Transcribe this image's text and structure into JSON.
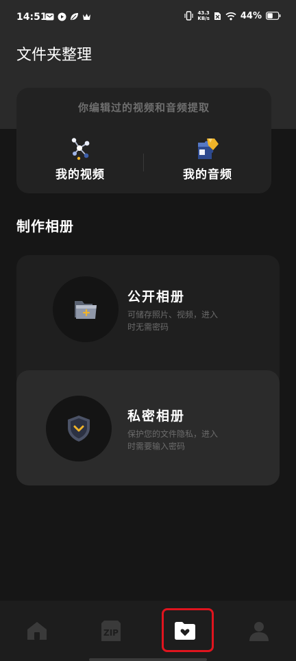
{
  "status_bar": {
    "time": "14:51",
    "net_speed_value": "43.3",
    "net_speed_unit": "KB/s",
    "battery_percent": "44%"
  },
  "page": {
    "title": "文件夹整理"
  },
  "extract_card": {
    "subtitle": "你编辑过的视频和音频提取",
    "items": [
      {
        "label": "我的视频",
        "icon": "video-dots-icon"
      },
      {
        "label": "我的音频",
        "icon": "puzzle-icon"
      }
    ]
  },
  "albums": {
    "section_title": "制作相册",
    "public": {
      "title": "公开相册",
      "desc_line1": "可储存照片、视频，进入",
      "desc_line2": "时无需密码",
      "icon": "folder-icon"
    },
    "private": {
      "title": "私密相册",
      "desc_line1": "保护您的文件隐私，进入",
      "desc_line2": "时需要输入密码",
      "icon": "shield-icon"
    }
  },
  "bottom_nav": {
    "zip_label": "ZIP",
    "active_index": 2,
    "items": [
      "home-icon",
      "zip-icon",
      "folder-heart-icon",
      "user-icon"
    ]
  },
  "colors": {
    "accent_red": "#e0141e",
    "gold": "#f0b429",
    "blue": "#3d5ea8"
  }
}
